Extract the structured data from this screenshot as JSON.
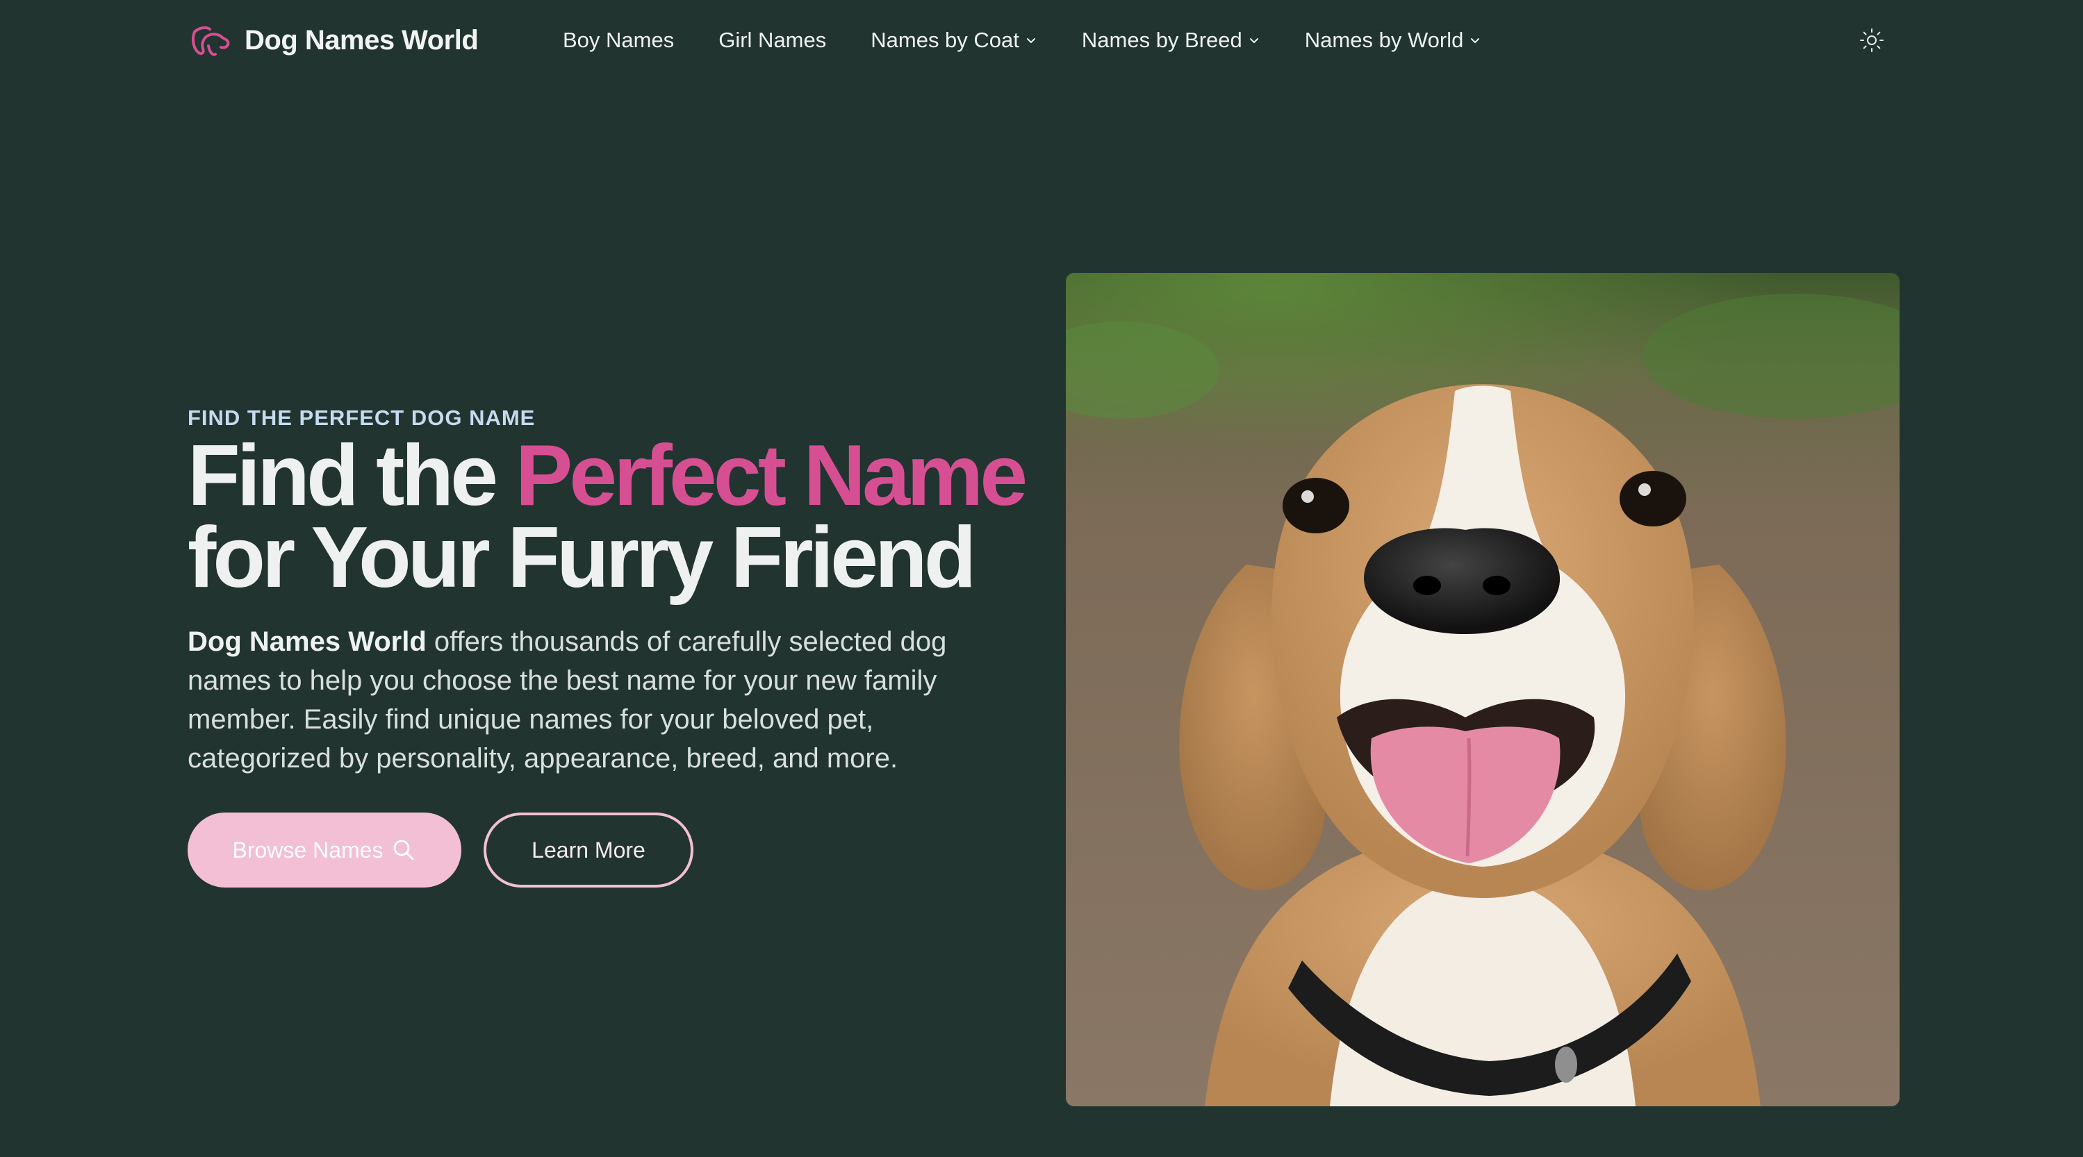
{
  "brand": {
    "name": "Dog Names World",
    "logo_icon": "dog-head-icon",
    "accent": "#d64f93"
  },
  "nav": {
    "items": [
      {
        "label": "Boy Names",
        "has_dropdown": false
      },
      {
        "label": "Girl Names",
        "has_dropdown": false
      },
      {
        "label": "Names by Coat",
        "has_dropdown": true
      },
      {
        "label": "Names by Breed",
        "has_dropdown": true
      },
      {
        "label": "Names by World",
        "has_dropdown": true
      }
    ],
    "theme_toggle_icon": "sun-icon"
  },
  "hero": {
    "eyebrow": "FIND THE PERFECT DOG NAME",
    "headline_start": "Find the",
    "headline_accent": "Perfect Name",
    "headline_end": "for Your Furry Friend",
    "intro_strong": "Dog Names World",
    "intro_text": "offers thousands of carefully selected dog names to help you choose the best name for your new family member. Easily find unique names for your beloved pet, categorized by personality, appearance, breed, and more.",
    "primary_button": "Browse Names",
    "primary_button_icon": "search-icon",
    "secondary_button": "Learn More",
    "image_subject": "beagle-photo"
  },
  "colors": {
    "background": "#213430",
    "button_pink": "#f2bfd4",
    "eyebrow_blue": "#c5dcf0"
  }
}
